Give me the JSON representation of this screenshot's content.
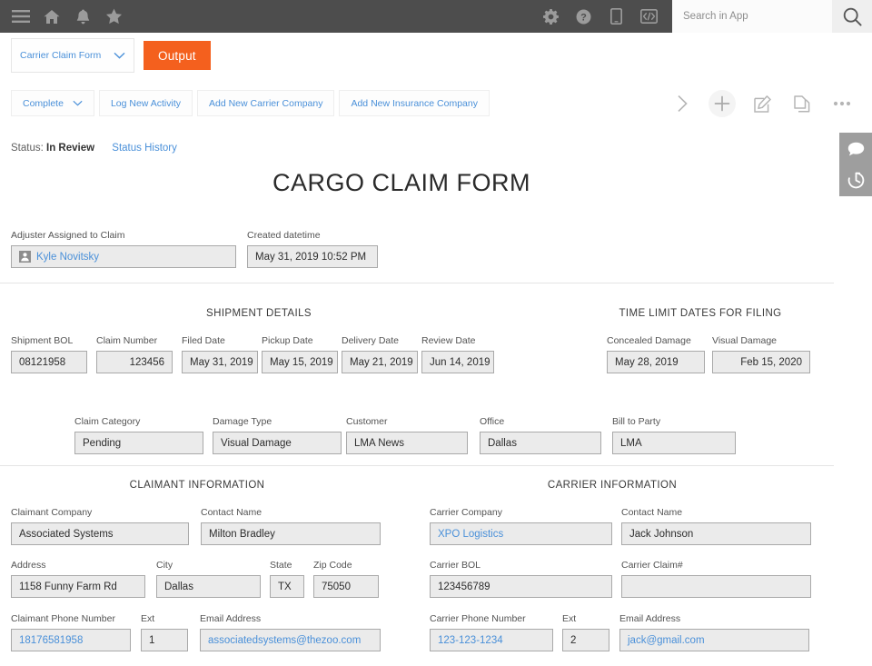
{
  "topbar": {
    "icons": [
      "menu-icon",
      "home-icon",
      "bell-icon",
      "star-icon"
    ],
    "right_icons": [
      "gear-icon",
      "help-icon",
      "mobile-icon",
      "code-icon"
    ],
    "search_placeholder": "Search in App",
    "search_value": "",
    "search_button": "search-icon",
    "bg_color": "#4d4d4d"
  },
  "form_selector": {
    "label": "Carrier Claim Form",
    "chevron": "chevron-down-icon"
  },
  "output_button": {
    "label": "Output",
    "color": "#f4601e"
  },
  "action_buttons": [
    {
      "label": "Complete",
      "has_chevron": true
    },
    {
      "label": "Log New Activity",
      "has_chevron": false
    },
    {
      "label": "Add New Carrier Company",
      "has_chevron": false
    },
    {
      "label": "Add New Insurance Company",
      "has_chevron": false
    }
  ],
  "action_icons": [
    "chevron-right-icon",
    "plus-icon",
    "edit-icon",
    "copy-icon",
    "more-icon"
  ],
  "status": {
    "prefix": "Status:",
    "value": "In Review",
    "history_link": "Status History"
  },
  "page_title": "CARGO CLAIM FORM",
  "header_fields": {
    "adjuster": {
      "label": "Adjuster Assigned to Claim",
      "value": "Kyle Novitsky",
      "icon": "user-icon"
    },
    "created": {
      "label": "Created datetime",
      "value": "May 31, 2019 10:52 PM"
    }
  },
  "shipment_details": {
    "heading": "SHIPMENT DETAILS",
    "fields": [
      {
        "label": "Shipment BOL",
        "value": "08121958",
        "align": "left"
      },
      {
        "label": "Claim Number",
        "value": "123456",
        "align": "right"
      },
      {
        "label": "Filed Date",
        "value": "May 31, 2019",
        "align": "left"
      },
      {
        "label": "Pickup Date",
        "value": "May 15, 2019",
        "align": "left"
      },
      {
        "label": "Delivery Date",
        "value": "May 21, 2019",
        "align": "left"
      },
      {
        "label": "Review Date",
        "value": "Jun 14, 2019",
        "align": "left"
      }
    ]
  },
  "time_limits": {
    "heading": "TIME LIMIT DATES FOR FILING",
    "fields": [
      {
        "label": "Concealed Damage",
        "value": "May 28, 2019",
        "align": "left"
      },
      {
        "label": "Visual Damage",
        "value": "Feb 15, 2020",
        "align": "right"
      }
    ]
  },
  "classification": {
    "fields": [
      {
        "label": "Claim Category",
        "value": "Pending"
      },
      {
        "label": "Damage Type",
        "value": "Visual Damage"
      },
      {
        "label": "Customer",
        "value": "LMA News"
      },
      {
        "label": "Office",
        "value": "Dallas"
      },
      {
        "label": "Bill to Party",
        "value": "LMA"
      }
    ]
  },
  "claimant": {
    "heading": "CLAIMANT INFORMATION",
    "company": {
      "label": "Claimant Company",
      "value": "Associated Systems"
    },
    "contact": {
      "label": "Contact Name",
      "value": "Milton Bradley"
    },
    "address": {
      "label": "Address",
      "value": "1158 Funny Farm Rd"
    },
    "city": {
      "label": "City",
      "value": "Dallas"
    },
    "state": {
      "label": "State",
      "value": "TX"
    },
    "zip": {
      "label": "Zip Code",
      "value": "75050"
    },
    "phone": {
      "label": "Claimant Phone Number",
      "value": "18176581958"
    },
    "ext": {
      "label": "Ext",
      "value": "1"
    },
    "email": {
      "label": "Email Address",
      "value": "associatedsystems@thezoo.com"
    }
  },
  "carrier": {
    "heading": "CARRIER INFORMATION",
    "company": {
      "label": "Carrier Company",
      "value": "XPO Logistics"
    },
    "contact": {
      "label": "Contact Name",
      "value": "Jack Johnson"
    },
    "bol": {
      "label": "Carrier BOL",
      "value": "123456789"
    },
    "claim_no": {
      "label": "Carrier Claim#",
      "value": ""
    },
    "phone": {
      "label": "Carrier Phone Number",
      "value": "123-123-1234"
    },
    "ext": {
      "label": "Ext",
      "value": "2"
    },
    "email": {
      "label": "Email Address",
      "value": "jack@gmail.com"
    }
  },
  "sidedock": {
    "icons": [
      "comment-icon",
      "history-icon"
    ],
    "bg_color": "#9e9e9e"
  },
  "colors": {
    "link": "#4a90d9",
    "accent": "#f4601e",
    "field_bg": "#ebebeb",
    "field_border": "#a9a9a9"
  }
}
